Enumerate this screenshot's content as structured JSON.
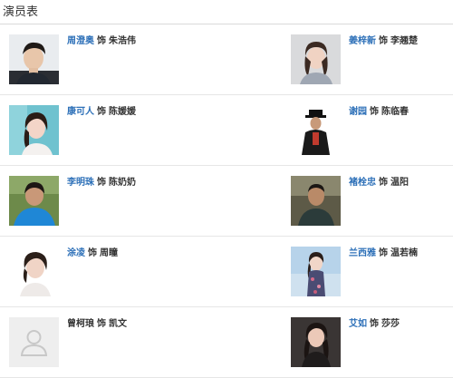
{
  "header": {
    "title": "演员表"
  },
  "as_word": "饰",
  "cast": [
    {
      "actor": "周澄奥",
      "role": "朱浩伟",
      "photo": "photo-male-young",
      "linked": true
    },
    {
      "actor": "姜梓新",
      "role": "李翘楚",
      "photo": "photo-female-grey",
      "linked": true
    },
    {
      "actor": "康可人",
      "role": "陈媛媛",
      "photo": "photo-female-teal",
      "linked": true
    },
    {
      "actor": "谢园",
      "role": "陈临春",
      "photo": "photo-male-hat",
      "linked": true
    },
    {
      "actor": "李明珠",
      "role": "陈奶奶",
      "photo": "photo-female-blue",
      "linked": true
    },
    {
      "actor": "褚栓忠",
      "role": "温阳",
      "photo": "photo-male-outdoor",
      "linked": true
    },
    {
      "actor": "涂凌",
      "role": "周瞳",
      "photo": "photo-female-white",
      "linked": true
    },
    {
      "actor": "兰西雅",
      "role": "温若楠",
      "photo": "photo-female-floral",
      "linked": true
    },
    {
      "actor": "曾柯琅",
      "role": "凯文",
      "photo": "placeholder-avatar",
      "linked": false
    },
    {
      "actor": "艾如",
      "role": "莎莎",
      "photo": "photo-female-dark",
      "linked": true
    }
  ],
  "colors": {
    "link": "#2d70b8",
    "text": "#333333",
    "divider": "#e6e6e6"
  }
}
